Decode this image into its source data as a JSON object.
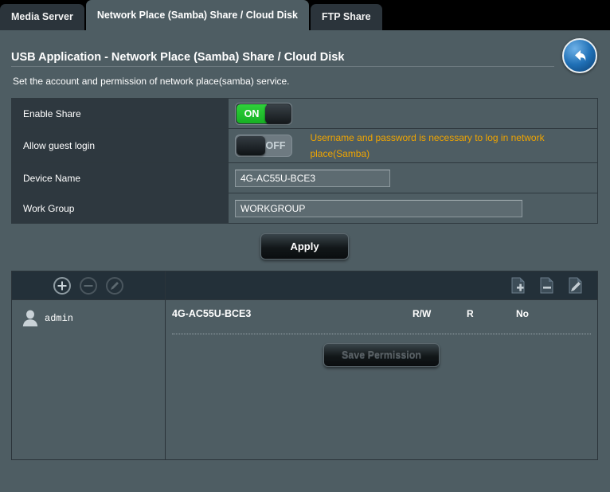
{
  "tabs": [
    {
      "label": "Media Server",
      "active": false
    },
    {
      "label": "Network Place (Samba) Share / Cloud Disk",
      "active": true
    },
    {
      "label": "FTP Share",
      "active": false
    }
  ],
  "header": {
    "title": "USB Application - Network Place (Samba) Share / Cloud Disk",
    "subtitle": "Set the account and permission of network place(samba) service.",
    "back_icon": "back-arrow-icon"
  },
  "settings": {
    "enable_share": {
      "label": "Enable Share",
      "toggle_state": "ON",
      "on_label": "ON"
    },
    "allow_guest_login": {
      "label": "Allow guest login",
      "toggle_state": "OFF",
      "off_label": "OFF",
      "hint": "Username and password is necessary to log in network place(Samba)"
    },
    "device_name": {
      "label": "Device Name",
      "value": "4G-AC55U-BCE3",
      "placeholder": ""
    },
    "work_group": {
      "label": "Work Group",
      "value": "WORKGROUP",
      "placeholder": ""
    },
    "apply_label": "Apply"
  },
  "panel": {
    "toolbar_left": [
      {
        "name": "add-user-icon",
        "glyph": "plus",
        "enabled": true
      },
      {
        "name": "remove-user-icon",
        "glyph": "minus",
        "enabled": false
      },
      {
        "name": "edit-user-icon",
        "glyph": "pencil",
        "enabled": false
      }
    ],
    "toolbar_right": [
      {
        "name": "add-folder-icon",
        "glyph": "doc-plus"
      },
      {
        "name": "remove-folder-icon",
        "glyph": "doc-minus"
      },
      {
        "name": "edit-folder-icon",
        "glyph": "doc-pencil"
      }
    ],
    "users": [
      {
        "name": "admin",
        "avatar_icon": "user-avatar-icon"
      }
    ],
    "shares": [
      {
        "name": "4G-AC55U-BCE3",
        "permissions": [
          "R/W",
          "R",
          "No"
        ]
      }
    ],
    "save_permission_label": "Save Permission",
    "save_permission_disabled": true
  },
  "colors": {
    "page_bg": "#4e5d63",
    "label_bg": "#2e383f",
    "toolbar_bg": "#233039",
    "tab_inactive": "#2b343b",
    "accent_warning": "#f0a500",
    "toggle_on_green": "#2fd13a",
    "back_button_blue": "#1f6fb5"
  }
}
